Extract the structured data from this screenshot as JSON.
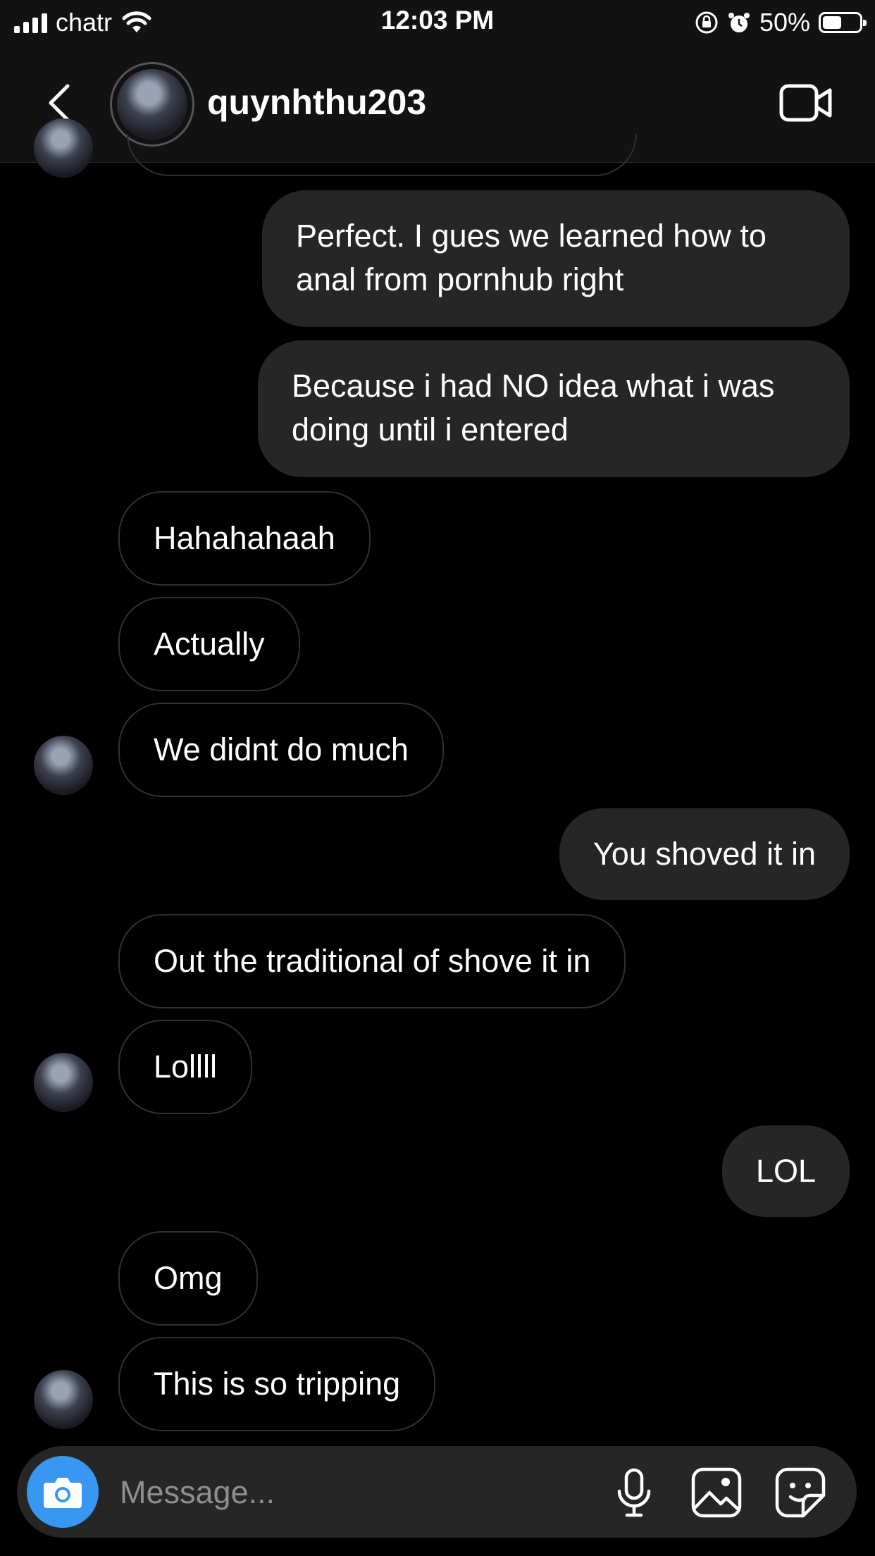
{
  "status_bar": {
    "carrier": "chatr",
    "time": "12:03 PM",
    "battery_percent": "50%",
    "battery_level": 0.5,
    "icons": [
      "signal-icon",
      "wifi-icon",
      "rotation-lock-icon",
      "alarm-icon",
      "battery-icon"
    ]
  },
  "header": {
    "username": "quynhthu203",
    "icons": [
      "back-arrow-icon",
      "video-call-icon"
    ]
  },
  "messages": [
    {
      "side": "sent",
      "text": "Perfect. I gues we learned how to\nanal from pornhub right"
    },
    {
      "side": "sent",
      "text": "Because i had NO idea what i was\ndoing until i entered"
    },
    {
      "side": "received",
      "text": "Hahahahaah"
    },
    {
      "side": "received",
      "text": "Actually"
    },
    {
      "side": "received",
      "text": "We didnt do much",
      "avatar": true
    },
    {
      "side": "sent",
      "text": "You shoved it in"
    },
    {
      "side": "received",
      "text": "Out the traditional of shove it in"
    },
    {
      "side": "received",
      "text": "Lollll",
      "avatar": true
    },
    {
      "side": "sent",
      "text": "LOL"
    },
    {
      "side": "received",
      "text": "Omg"
    },
    {
      "side": "received",
      "text": "This is so tripping",
      "avatar": true
    }
  ],
  "composer": {
    "placeholder": "Message...",
    "icons": [
      "camera-icon",
      "microphone-icon",
      "gallery-icon",
      "sticker-icon"
    ]
  },
  "colors": {
    "background": "#000000",
    "sent_bubble": "#262626",
    "received_border": "#303030",
    "camera_button": "#3897f0"
  }
}
